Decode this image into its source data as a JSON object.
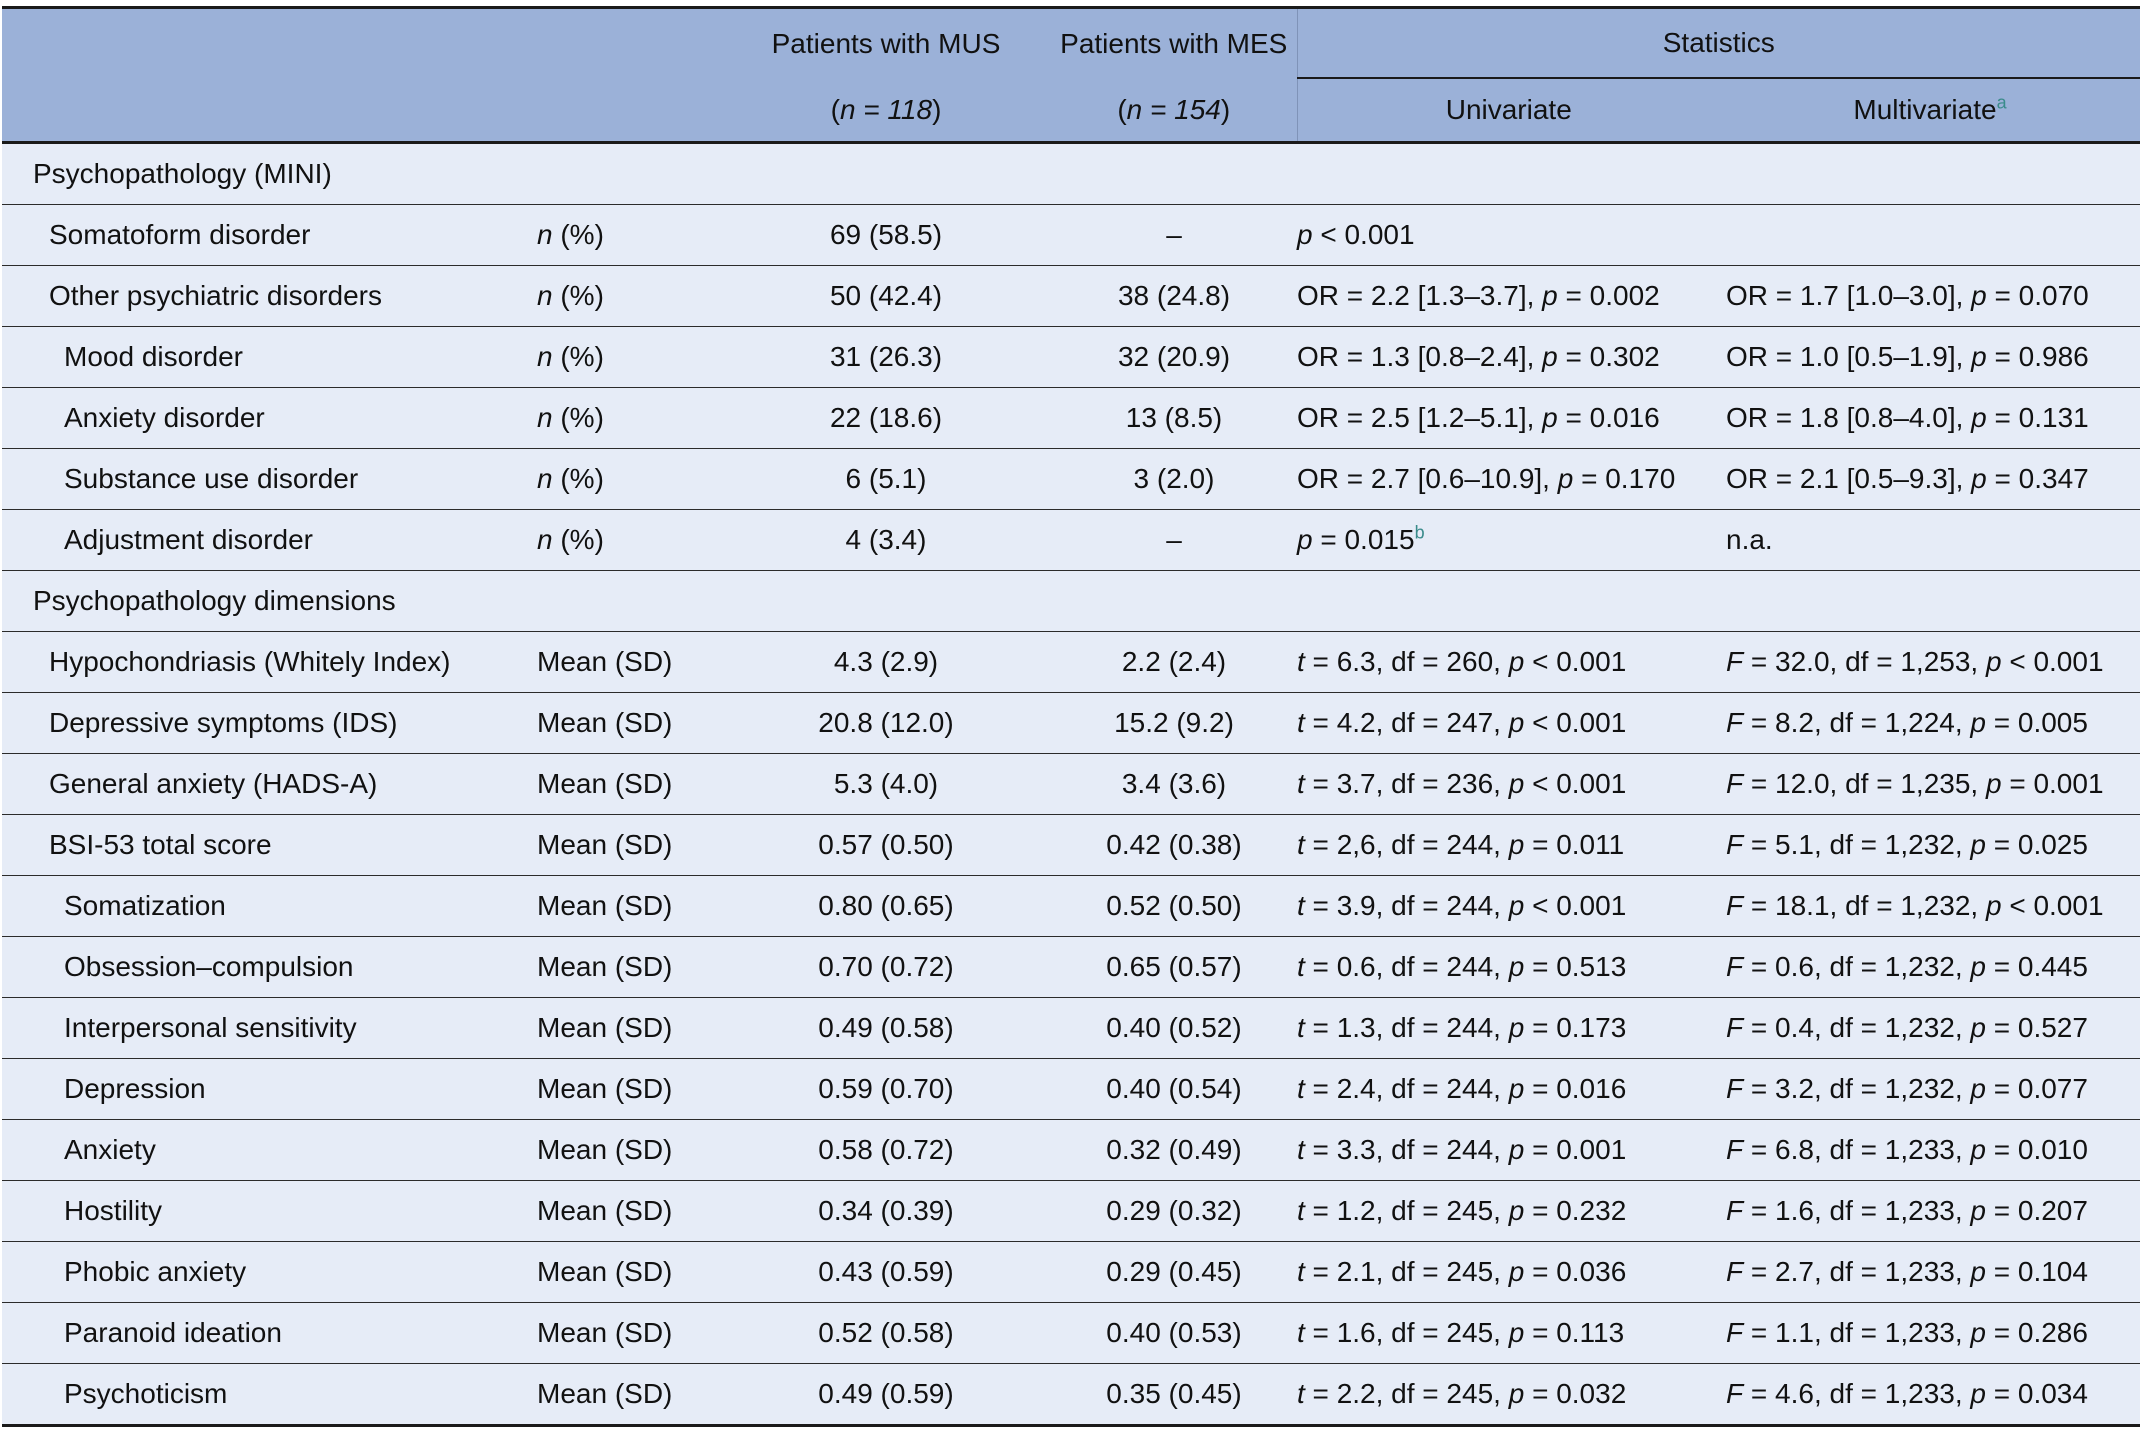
{
  "header": {
    "col_mus": "Patients with MUS",
    "col_mes": "Patients with MES",
    "col_stats": "Statistics",
    "n_mus": "n = 118",
    "n_mes": "n = 154",
    "univariate": "Univariate",
    "multivariate": "Multivariate",
    "multivariate_note": "a"
  },
  "rows": [
    {
      "kind": "section",
      "label": "Psychopathology (MINI)"
    },
    {
      "kind": "row",
      "indent": 1,
      "label": "Somatoform disorder",
      "type": "n (%)",
      "mus": "69 (58.5)",
      "mes": "–",
      "uni": "p < 0.001",
      "multi": ""
    },
    {
      "kind": "row",
      "indent": 1,
      "label": "Other psychiatric disorders",
      "type": "n (%)",
      "mus": "50 (42.4)",
      "mes": "38 (24.8)",
      "uni": "OR = 2.2 [1.3–3.7], p = 0.002",
      "multi": "OR = 1.7 [1.0–3.0], p = 0.070"
    },
    {
      "kind": "row",
      "indent": 2,
      "label": "Mood disorder",
      "type": "n (%)",
      "mus": "31 (26.3)",
      "mes": "32 (20.9)",
      "uni": "OR = 1.3 [0.8–2.4], p = 0.302",
      "multi": "OR = 1.0 [0.5–1.9], p = 0.986"
    },
    {
      "kind": "row",
      "indent": 2,
      "label": "Anxiety disorder",
      "type": "n (%)",
      "mus": "22 (18.6)",
      "mes": "13 (8.5)",
      "uni": "OR = 2.5 [1.2–5.1], p = 0.016",
      "multi": "OR = 1.8 [0.8–4.0], p = 0.131"
    },
    {
      "kind": "row",
      "indent": 2,
      "label": "Substance use disorder",
      "type": "n (%)",
      "mus": "6 (5.1)",
      "mes": "3 (2.0)",
      "uni": "OR = 2.7 [0.6–10.9], p = 0.170",
      "multi": "OR = 2.1 [0.5–9.3], p = 0.347"
    },
    {
      "kind": "row",
      "indent": 2,
      "label": "Adjustment disorder",
      "type": "n (%)",
      "mus": "4 (3.4)",
      "mes": "–",
      "uni": "p = 0.015",
      "uni_note": "b",
      "multi": "n.a."
    },
    {
      "kind": "section",
      "label": "Psychopathology dimensions"
    },
    {
      "kind": "row",
      "indent": 1,
      "label": "Hypochondriasis (Whitely Index)",
      "type": "Mean (SD)",
      "mus": "4.3 (2.9)",
      "mes": "2.2 (2.4)",
      "uni": "t = 6.3, df = 260, p < 0.001",
      "multi": "F = 32.0, df = 1,253, p < 0.001"
    },
    {
      "kind": "row",
      "indent": 1,
      "label": "Depressive symptoms (IDS)",
      "type": "Mean (SD)",
      "mus": "20.8 (12.0)",
      "mes": "15.2 (9.2)",
      "uni": "t = 4.2, df = 247, p < 0.001",
      "multi": "F = 8.2, df = 1,224, p = 0.005"
    },
    {
      "kind": "row",
      "indent": 1,
      "label": "General anxiety (HADS-A)",
      "type": "Mean (SD)",
      "mus": "5.3 (4.0)",
      "mes": "3.4 (3.6)",
      "uni": "t = 3.7, df = 236, p < 0.001",
      "multi": "F = 12.0, df = 1,235, p = 0.001"
    },
    {
      "kind": "row",
      "indent": 1,
      "label": "BSI-53 total score",
      "type": "Mean (SD)",
      "mus": "0.57 (0.50)",
      "mes": "0.42 (0.38)",
      "uni": "t = 2,6, df = 244, p = 0.011",
      "multi": "F = 5.1, df = 1,232, p = 0.025"
    },
    {
      "kind": "row",
      "indent": 2,
      "label": "Somatization",
      "type": "Mean (SD)",
      "mus": "0.80 (0.65)",
      "mes": "0.52 (0.50)",
      "uni": "t = 3.9, df = 244, p < 0.001",
      "multi": "F = 18.1, df = 1,232, p < 0.001"
    },
    {
      "kind": "row",
      "indent": 2,
      "label": "Obsession–compulsion",
      "type": "Mean (SD)",
      "mus": "0.70 (0.72)",
      "mes": "0.65 (0.57)",
      "uni": "t = 0.6, df = 244, p = 0.513",
      "multi": "F = 0.6, df = 1,232, p = 0.445"
    },
    {
      "kind": "row",
      "indent": 2,
      "label": "Interpersonal sensitivity",
      "type": "Mean (SD)",
      "mus": "0.49 (0.58)",
      "mes": "0.40 (0.52)",
      "uni": "t = 1.3, df = 244, p = 0.173",
      "multi": "F = 0.4, df = 1,232, p = 0.527"
    },
    {
      "kind": "row",
      "indent": 2,
      "label": "Depression",
      "type": "Mean (SD)",
      "mus": "0.59 (0.70)",
      "mes": "0.40 (0.54)",
      "uni": "t = 2.4, df = 244, p = 0.016",
      "multi": "F = 3.2, df = 1,232, p = 0.077"
    },
    {
      "kind": "row",
      "indent": 2,
      "label": "Anxiety",
      "type": "Mean (SD)",
      "mus": "0.58 (0.72)",
      "mes": "0.32 (0.49)",
      "uni": "t = 3.3, df = 244, p = 0.001",
      "multi": "F = 6.8, df = 1,233, p = 0.010"
    },
    {
      "kind": "row",
      "indent": 2,
      "label": "Hostility",
      "type": "Mean (SD)",
      "mus": "0.34 (0.39)",
      "mes": "0.29 (0.32)",
      "uni": "t = 1.2, df = 245, p = 0.232",
      "multi": "F = 1.6, df = 1,233, p = 0.207"
    },
    {
      "kind": "row",
      "indent": 2,
      "label": "Phobic anxiety",
      "type": "Mean (SD)",
      "mus": "0.43 (0.59)",
      "mes": "0.29 (0.45)",
      "uni": "t = 2.1, df = 245, p = 0.036",
      "multi": "F = 2.7, df = 1,233, p = 0.104"
    },
    {
      "kind": "row",
      "indent": 2,
      "label": "Paranoid ideation",
      "type": "Mean (SD)",
      "mus": "0.52 (0.58)",
      "mes": "0.40 (0.53)",
      "uni": "t = 1.6, df = 245, p = 0.113",
      "multi": "F = 1.1, df = 1,233, p = 0.286"
    },
    {
      "kind": "row",
      "indent": 2,
      "label": "Psychoticism",
      "type": "Mean (SD)",
      "mus": "0.49 (0.59)",
      "mes": "0.35 (0.45)",
      "uni": "t = 2.2, df = 245, p = 0.032",
      "multi": "F = 4.6, df = 1,233, p = 0.034"
    }
  ]
}
